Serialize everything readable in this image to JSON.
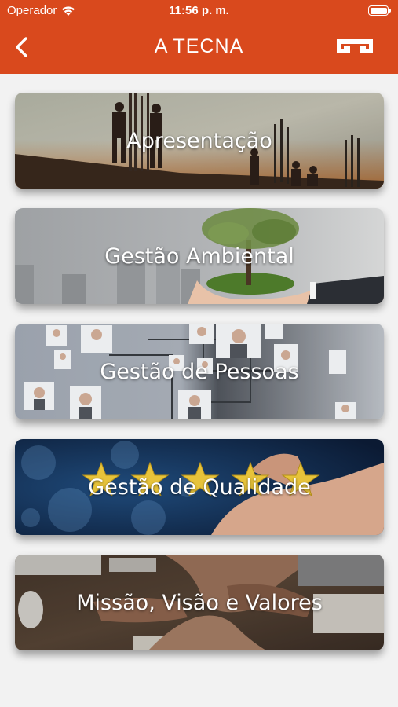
{
  "status_bar": {
    "carrier": "Operador",
    "time": "11:56 p. m."
  },
  "header": {
    "title": "A TECNA",
    "back_icon": "chevron-left-icon",
    "logo_icon": "tecna-logo-icon",
    "color": "#d9491d"
  },
  "menu": {
    "items": [
      {
        "label": "Apresentação",
        "image": "construction-workers-image"
      },
      {
        "label": "Gestão Ambiental",
        "image": "tree-in-hands-image"
      },
      {
        "label": "Gestão de Pessoas",
        "image": "people-network-image"
      },
      {
        "label": "Gestão de Qualidade",
        "image": "quality-stars-image"
      },
      {
        "label": "Missão, Visão e Valores",
        "image": "team-hands-image"
      }
    ]
  }
}
